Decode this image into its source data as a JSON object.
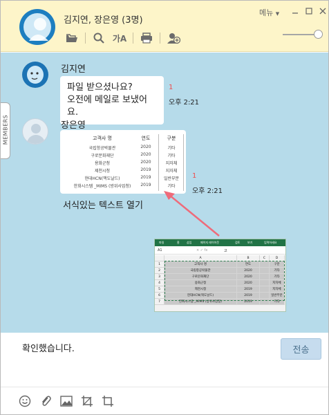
{
  "header": {
    "title": "김지연, 장은영 (3명)",
    "menu_label": "메뉴",
    "tools": [
      "folder-icon",
      "search-icon",
      "font-size-icon",
      "print-icon",
      "add-person-icon"
    ],
    "font_tool_label": "가A"
  },
  "sidebar": {
    "members_label": "MEMBERS"
  },
  "messages": [
    {
      "sender": "김지연",
      "lines": [
        "파일 받으셨나요?",
        "오전에 메일로 보냈어요."
      ],
      "unread": "1",
      "time": "오후 2:21"
    },
    {
      "sender": "장은영",
      "table": {
        "headers": [
          "고객사 명",
          "연도",
          "구분"
        ],
        "rows": [
          [
            "국립항공박물관",
            "2020",
            "기타"
          ],
          [
            "구로문화재단",
            "2020",
            "기타"
          ],
          [
            "용화군청",
            "2020",
            "지자체"
          ],
          [
            "제천시청",
            "2019",
            "지자체"
          ],
          [
            "현대HCN(맥도날드)",
            "2019",
            "일반부분"
          ],
          [
            "한화시스템 _MIMS (방위사업청)",
            "2019",
            "기타"
          ]
        ]
      },
      "unread": "1",
      "time": "오후 2:21",
      "link_text": "서식있는 텍스트 열기"
    }
  ],
  "excel_preview": {
    "ribbon_tabs": [
      "파일",
      "홈",
      "삽입",
      "페이지 레이아웃",
      "검토",
      "보기",
      "입력하세요"
    ],
    "cell_ref": "A1",
    "formula": "고",
    "col_headers": [
      "A",
      "B",
      "C",
      "D"
    ],
    "rows": [
      [
        "1",
        "고객사 명",
        "연도",
        "구분"
      ],
      [
        "2",
        "국립항공박물관",
        "2020",
        "기타"
      ],
      [
        "3",
        "구로문화재단",
        "2020",
        "기타"
      ],
      [
        "4",
        "용화군청",
        "2020",
        "지자체"
      ],
      [
        "5",
        "제천시청",
        "2019",
        "지자체"
      ],
      [
        "6",
        "현대HCN(맥도날드)",
        "2019",
        "일반부분"
      ],
      [
        "7",
        "한화시스템 _MIMS (방위사업청)",
        "2019",
        "기타"
      ]
    ]
  },
  "input": {
    "value": "확인했습니다.",
    "send_label": "전송"
  },
  "bottom_tools": [
    "emoji-icon",
    "attach-icon",
    "image-icon",
    "capture-icon",
    "crop-icon"
  ],
  "colors": {
    "header_bg": "#fdf5c9",
    "chat_bg": "#b6dbea",
    "send_btn": "#c6dcee",
    "unread": "#f04c4c",
    "arrow": "#ee6b7a"
  }
}
